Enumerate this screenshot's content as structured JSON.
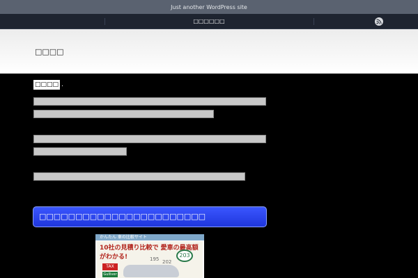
{
  "site": {
    "tagline": "Just another WordPress site"
  },
  "nav": {
    "item": "□□□□□□"
  },
  "header": {
    "title": "□□□□"
  },
  "post": {
    "title": "□□□□",
    "lines": [
      {
        "text": ""
      },
      {
        "text": ""
      },
      {
        "text": ""
      },
      {
        "text": ""
      },
      {
        "text": ""
      }
    ]
  },
  "ad": {
    "heading": "□□□□□□□□□□□□□□□□□□□□□□□",
    "banner": {
      "strip": "かんたん 車の比較サイト",
      "headline": "10社の見積り比較で 愛車の最高額がわかる!",
      "tax": "TAX",
      "gulliver": "Gulliver",
      "price_1": "195",
      "price_2": "202",
      "price_3": "203"
    }
  },
  "colors": {
    "accent": "#2a45f0",
    "navbar": "#1e2430",
    "topbar": "#5a6270"
  },
  "icons": {
    "rss": "rss-icon"
  }
}
